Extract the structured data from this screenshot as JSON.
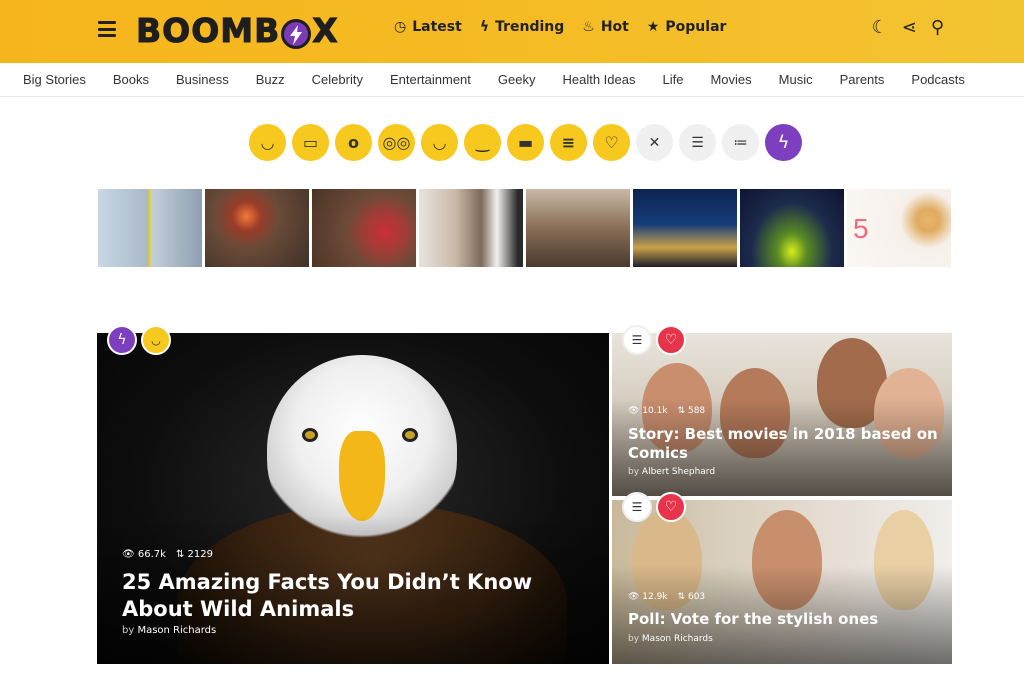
{
  "header": {
    "logo_text": "BOOMBOX",
    "nav": [
      {
        "label": "Latest",
        "icon": "clock-icon"
      },
      {
        "label": "Trending",
        "icon": "bolt-icon"
      },
      {
        "label": "Hot",
        "icon": "flame-icon"
      },
      {
        "label": "Popular",
        "icon": "star-icon"
      }
    ],
    "right_icons": [
      "moon-icon",
      "share-icon",
      "search-icon"
    ],
    "bg_color": "#f5bb24"
  },
  "categories": [
    "Big Stories",
    "Books",
    "Business",
    "Buzz",
    "Celebrity",
    "Entertainment",
    "Geeky",
    "Health Ideas",
    "Life",
    "Movies",
    "Music",
    "Parents",
    "Podcasts"
  ],
  "reactions": [
    {
      "name": "lol-reaction",
      "glyph": "😂"
    },
    {
      "name": "omg-reaction",
      "glyph": "😬"
    },
    {
      "name": "wow-reaction",
      "glyph": "😮"
    },
    {
      "name": "geeky-reaction",
      "glyph": "🤓"
    },
    {
      "name": "wtf-reaction",
      "glyph": "😝"
    },
    {
      "name": "cute-reaction",
      "glyph": "😊"
    },
    {
      "name": "cool-reaction",
      "glyph": "😎"
    },
    {
      "name": "angry-reaction",
      "glyph": "😑"
    },
    {
      "name": "love-reaction",
      "glyph": "😍"
    },
    {
      "name": "versus-reaction",
      "glyph": "✕"
    },
    {
      "name": "quiz-reaction",
      "glyph": "☰"
    },
    {
      "name": "list-reaction",
      "glyph": "≔"
    },
    {
      "name": "trending-reaction",
      "glyph": "⚡"
    }
  ],
  "thumbnails": [
    "Golden Gate and Tower Bridge",
    "DJ with headphones",
    "Gift wrapping",
    "Woman by window",
    "Crowd of friends",
    "City skyline at night",
    "Tent under aurora",
    "5 Quick & Easy Breakfast Recipes"
  ],
  "hero": {
    "views": "66.7k",
    "shares": "2129",
    "title": "25 Amazing Facts You Didn’t Know About Wild Animals",
    "by": "by",
    "author": "Mason Richards"
  },
  "card1": {
    "views": "10.1k",
    "shares": "588",
    "title": "Story: Best movies in 2018 based on Comics",
    "by": "by",
    "author": "Albert Shephard"
  },
  "card2": {
    "views": "12.9k",
    "shares": "603",
    "title": "Poll: Vote for the stylish ones",
    "by": "by",
    "author": "Mason Richards"
  },
  "colors": {
    "accent_purple": "#7d3fbf",
    "reaction_yellow": "#f7c81e",
    "heart_red": "#e8344a"
  }
}
